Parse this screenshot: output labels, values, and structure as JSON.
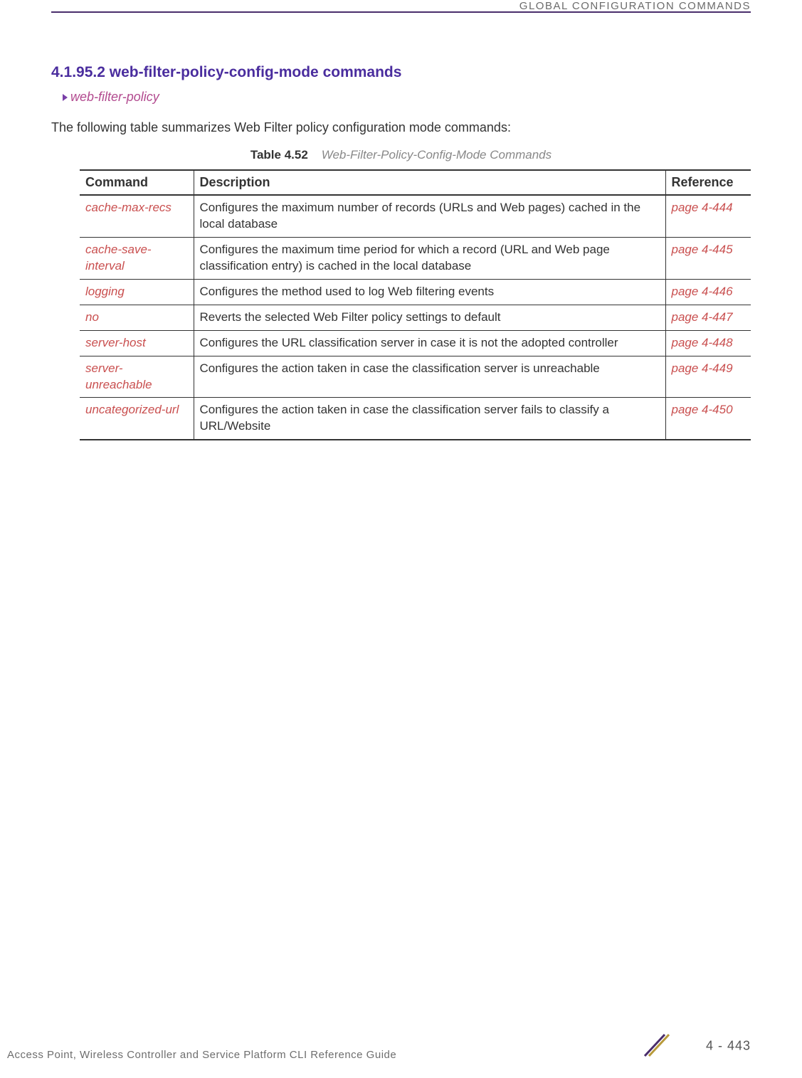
{
  "header": {
    "right_text": "GLOBAL CONFIGURATION COMMANDS"
  },
  "section": {
    "heading": "4.1.95.2 web-filter-policy-config-mode commands",
    "breadcrumb": "web-filter-policy",
    "intro": "The following table summarizes Web Filter policy configuration mode commands:"
  },
  "table": {
    "caption_label": "Table 4.52",
    "caption_title": "Web-Filter-Policy-Config-Mode Commands",
    "headers": {
      "command": "Command",
      "description": "Description",
      "reference": "Reference"
    },
    "rows": [
      {
        "command": "cache-max-recs",
        "description": "Configures the maximum number of records (URLs and Web pages) cached in the local database",
        "reference": "page 4-444"
      },
      {
        "command": "cache-save-interval",
        "description": "Configures the maximum time period for which a record (URL and Web page classification entry) is cached in the local database",
        "reference": "page 4-445"
      },
      {
        "command": "logging",
        "description": "Configures the method used to log Web filtering events",
        "reference": "page 4-446"
      },
      {
        "command": "no",
        "description": "Reverts the selected Web Filter policy settings to default",
        "reference": "page 4-447"
      },
      {
        "command": "server-host",
        "description": "Configures the URL classification server in case it is not the adopted controller",
        "reference": "page 4-448"
      },
      {
        "command": "server-unreachable",
        "description": "Configures the action taken in case the classification server is unreachable",
        "reference": "page 4-449"
      },
      {
        "command": "uncategorized-url",
        "description": "Configures the action taken in case the classification server fails to classify a URL/Website",
        "reference": "page 4-450"
      }
    ]
  },
  "footer": {
    "left_text": "Access Point, Wireless Controller and Service Platform CLI Reference Guide",
    "page_number": "4 - 443"
  }
}
